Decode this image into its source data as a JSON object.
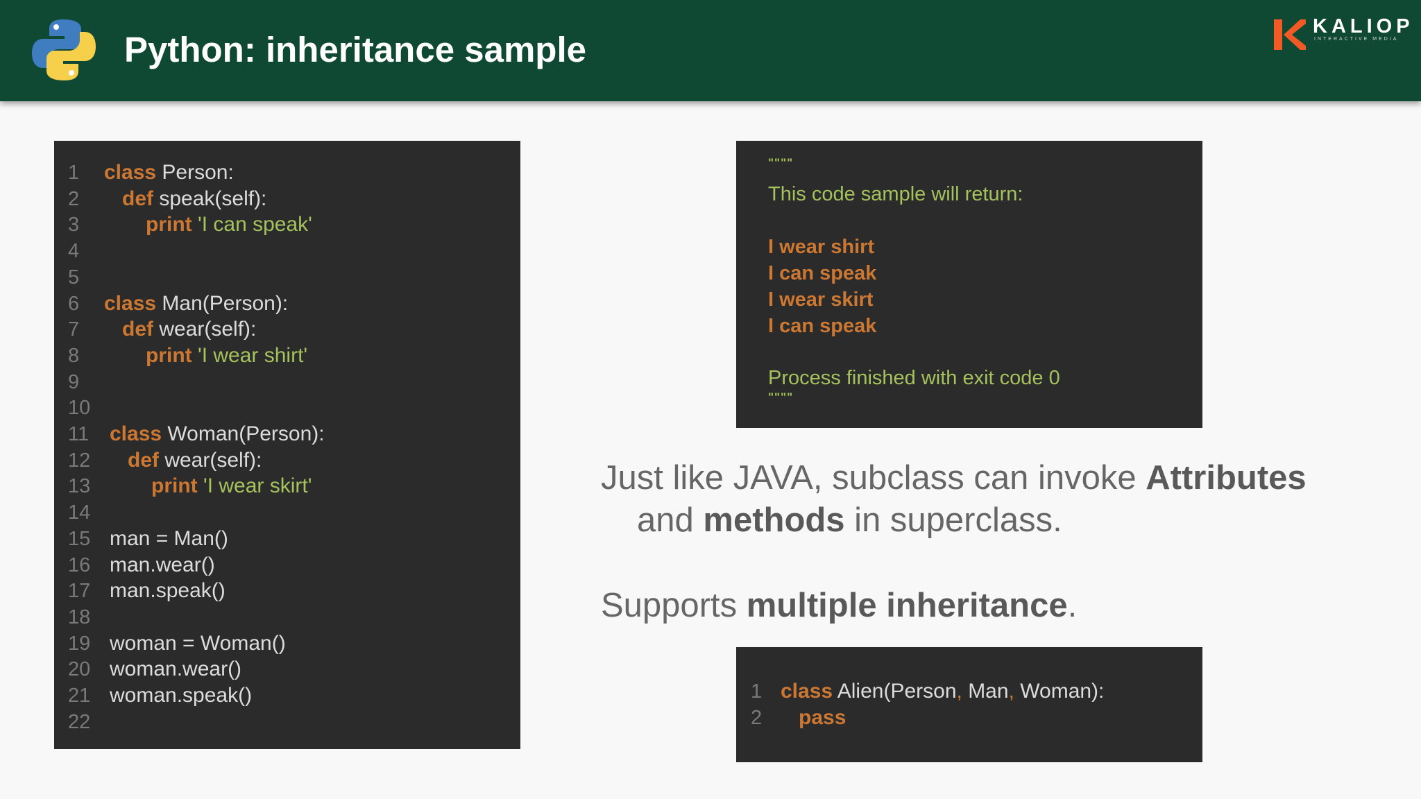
{
  "header": {
    "title": "Python: inheritance sample",
    "brand_name": "KALIOP",
    "brand_subtitle": "INTERACTIVE MEDIA",
    "logo_icon": "python-logo-icon",
    "brand_icon": "kaliop-k-icon",
    "background_color": "#0f4934"
  },
  "colors": {
    "code_background": "#2b2b2b",
    "keyword": "#cc7832",
    "string": "#a5c25c",
    "plain": "#dcdcdc",
    "line_number": "#7a7a7a",
    "brand_orange": "#f15a24"
  },
  "code_main": {
    "lines": [
      {
        "n": "1",
        "kw": "class",
        "text": " Person:"
      },
      {
        "n": "2",
        "kw": "def",
        "text": " speak(self):"
      },
      {
        "n": "3",
        "kw": "print",
        "str": " 'I can speak'"
      },
      {
        "n": "4"
      },
      {
        "n": "5"
      },
      {
        "n": "6",
        "kw": "class",
        "text": " Man(Person):"
      },
      {
        "n": "7",
        "kw": "def",
        "text": " wear(self):"
      },
      {
        "n": "8",
        "kw": "print",
        "str": " 'I wear shirt'"
      },
      {
        "n": "9"
      },
      {
        "n": "10"
      },
      {
        "n": "11",
        "kw": "class",
        "text": " Woman(Person):"
      },
      {
        "n": "12",
        "kw": "def",
        "text": " wear(self):"
      },
      {
        "n": "13",
        "kw": "print",
        "str": " 'I wear skirt'"
      },
      {
        "n": "14"
      },
      {
        "n": "15",
        "text": "man = Man()"
      },
      {
        "n": "16",
        "text": "man.wear()"
      },
      {
        "n": "17",
        "text": "man.speak()"
      },
      {
        "n": "18"
      },
      {
        "n": "19",
        "text": "woman = Woman()"
      },
      {
        "n": "20",
        "text": "woman.wear()"
      },
      {
        "n": "21",
        "text": "woman.speak()"
      },
      {
        "n": "22"
      }
    ]
  },
  "code_output": {
    "open_quote": "\"\"\"\"",
    "intro": "This code sample will return:",
    "results": [
      "I wear shirt",
      "I can speak",
      "I wear skirt",
      "I can speak"
    ],
    "finish": "Process finished with exit code 0",
    "close_quote": "\"\"\"\""
  },
  "bullets": {
    "b1_part1": "Just like JAVA, subclass can invoke ",
    "b1_bold1": "Attributes",
    "b1_part2": "and ",
    "b1_bold2": "methods",
    "b1_part3": " in superclass.",
    "b2_part1": "Supports ",
    "b2_bold": "multiple inheritance",
    "b2_part2": "."
  },
  "code_multi": {
    "line1_n": "1",
    "line1_kw": "class",
    "line1_name": " Alien(Person",
    "line1_c1": ",",
    "line1_mid": " Man",
    "line1_c2": ",",
    "line1_end": " Woman):",
    "line2_n": "2",
    "line2_kw": "pass"
  }
}
